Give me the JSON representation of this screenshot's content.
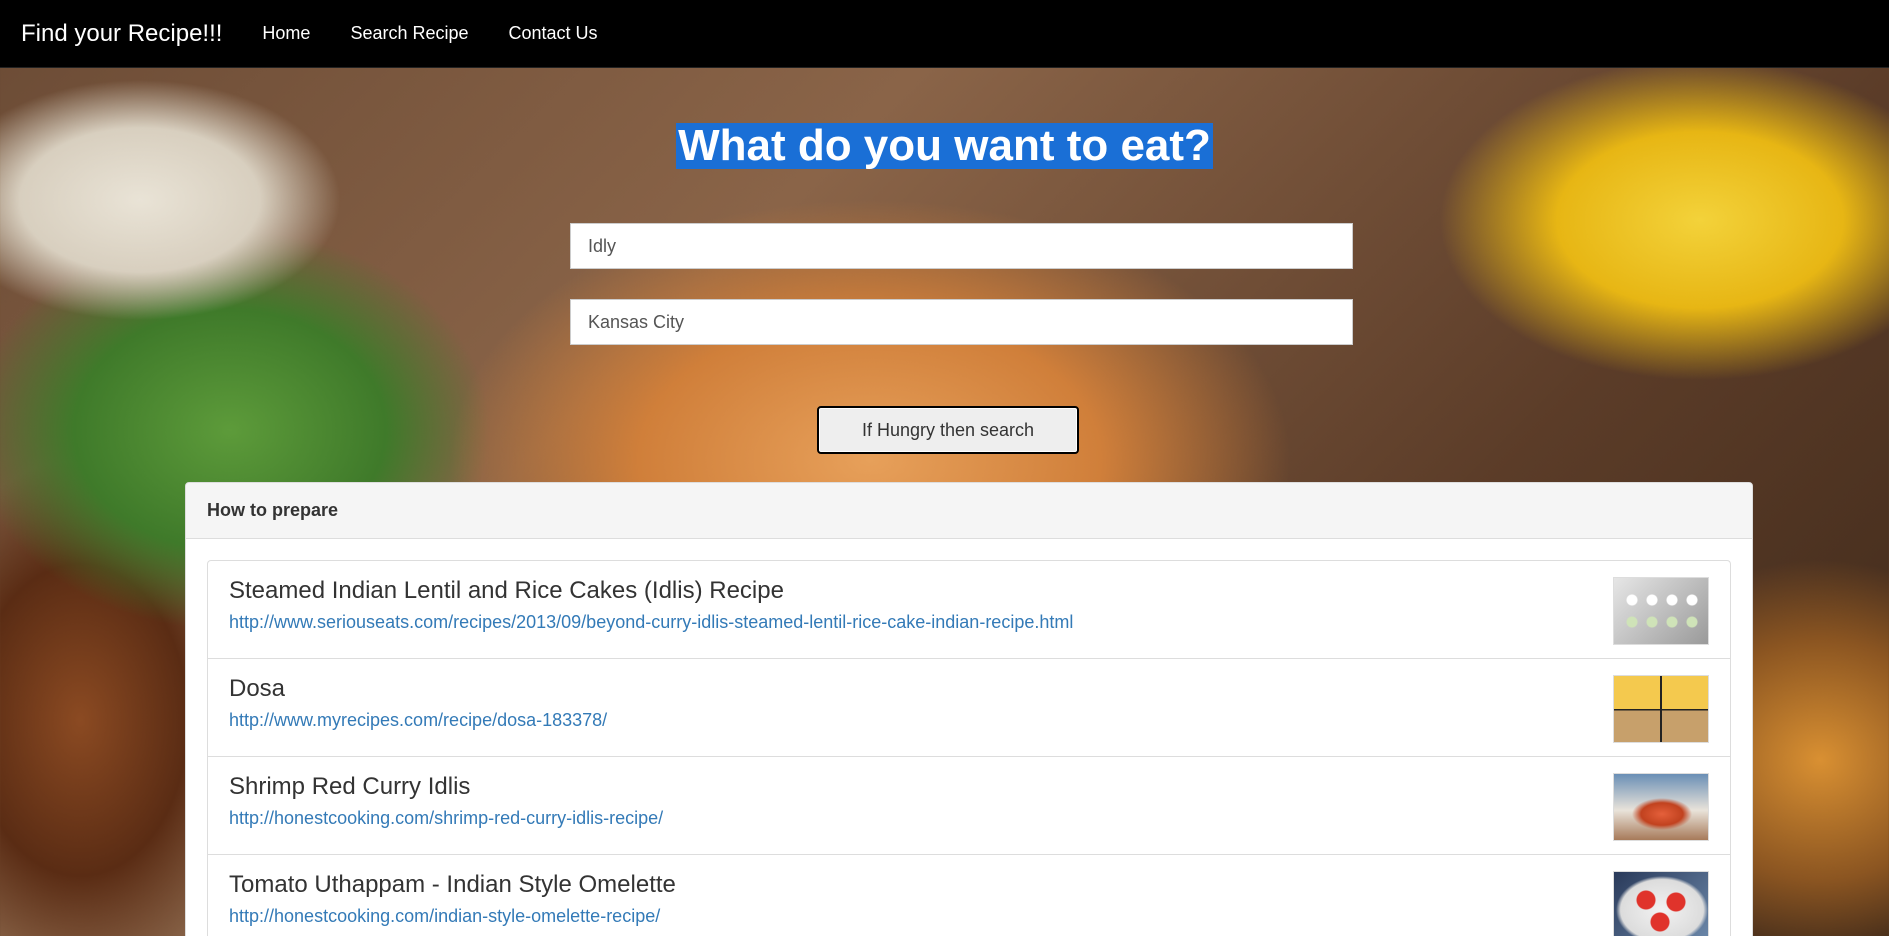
{
  "navbar": {
    "brand": "Find your Recipe!!!",
    "links": [
      {
        "label": "Home"
      },
      {
        "label": "Search Recipe"
      },
      {
        "label": "Contact Us"
      }
    ]
  },
  "hero": {
    "title": "What do you want to eat?"
  },
  "search": {
    "dish_value": "Idly",
    "city_value": "Kansas City",
    "button_label": "If Hungry then search"
  },
  "results": {
    "heading": "How to prepare",
    "items": [
      {
        "title": "Steamed Indian Lentil and Rice Cakes (Idlis) Recipe",
        "url": "http://www.seriouseats.com/recipes/2013/09/beyond-curry-idlis-steamed-lentil-rice-cake-indian-recipe.html"
      },
      {
        "title": "Dosa",
        "url": "http://www.myrecipes.com/recipe/dosa-183378/"
      },
      {
        "title": "Shrimp Red Curry Idlis",
        "url": "http://honestcooking.com/shrimp-red-curry-idlis-recipe/"
      },
      {
        "title": "Tomato Uthappam - Indian Style Omelette",
        "url": "http://honestcooking.com/indian-style-omelette-recipe/"
      }
    ]
  },
  "colors": {
    "navbar_bg": "#000000",
    "title_highlight": "#1a6fd6",
    "link": "#337ab7"
  }
}
